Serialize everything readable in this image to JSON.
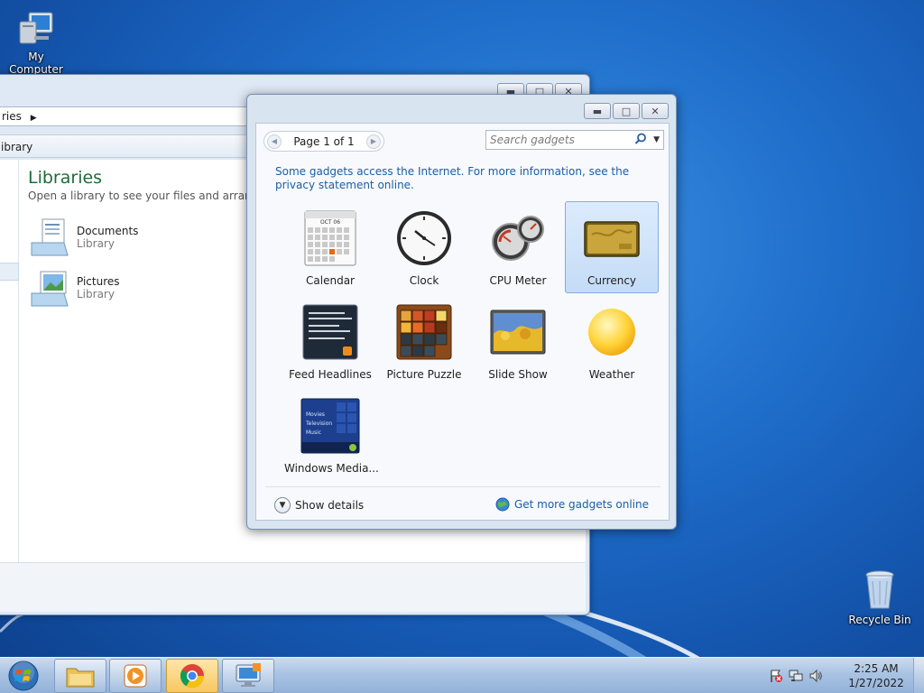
{
  "desktop": {
    "icons": [
      {
        "label": "My Computer"
      },
      {
        "label": "Recycle Bin"
      }
    ]
  },
  "explorer": {
    "address_text": "ries",
    "command_text": "ibrary",
    "title": "Libraries",
    "subtitle": "Open a library to see your files and arrange t",
    "items": [
      {
        "name": "Documents",
        "type": "Library"
      },
      {
        "name": "Pictures",
        "type": "Library"
      }
    ]
  },
  "gallery": {
    "page_label": "Page 1 of 1",
    "search_placeholder": "Search gadgets",
    "notice": "Some gadgets access the Internet.  For more information, see the privacy statement online.",
    "gadgets": [
      {
        "name": "Calendar",
        "icon": "calendar-icon"
      },
      {
        "name": "Clock",
        "icon": "clock-icon"
      },
      {
        "name": "CPU Meter",
        "icon": "cpu-meter-icon"
      },
      {
        "name": "Currency",
        "icon": "currency-icon",
        "selected": true
      },
      {
        "name": "Feed Headlines",
        "icon": "feed-headlines-icon"
      },
      {
        "name": "Picture Puzzle",
        "icon": "picture-puzzle-icon"
      },
      {
        "name": "Slide Show",
        "icon": "slide-show-icon"
      },
      {
        "name": "Weather",
        "icon": "weather-icon"
      },
      {
        "name": "Windows Media...",
        "icon": "windows-media-center-icon"
      }
    ],
    "calendar_month": "OCT 06",
    "media_menu": [
      "Movies",
      "Television",
      "Music"
    ],
    "show_details_label": "Show details",
    "get_more_label": "Get more gadgets online"
  },
  "taskbar": {
    "time": "2:25 AM",
    "date": "1/27/2022"
  },
  "colors": {
    "desktop_blue": "#1f6fcc",
    "link_blue": "#1a5ea8",
    "library_green": "#1e6b3a",
    "selection_blue": "#c4dcf7"
  }
}
